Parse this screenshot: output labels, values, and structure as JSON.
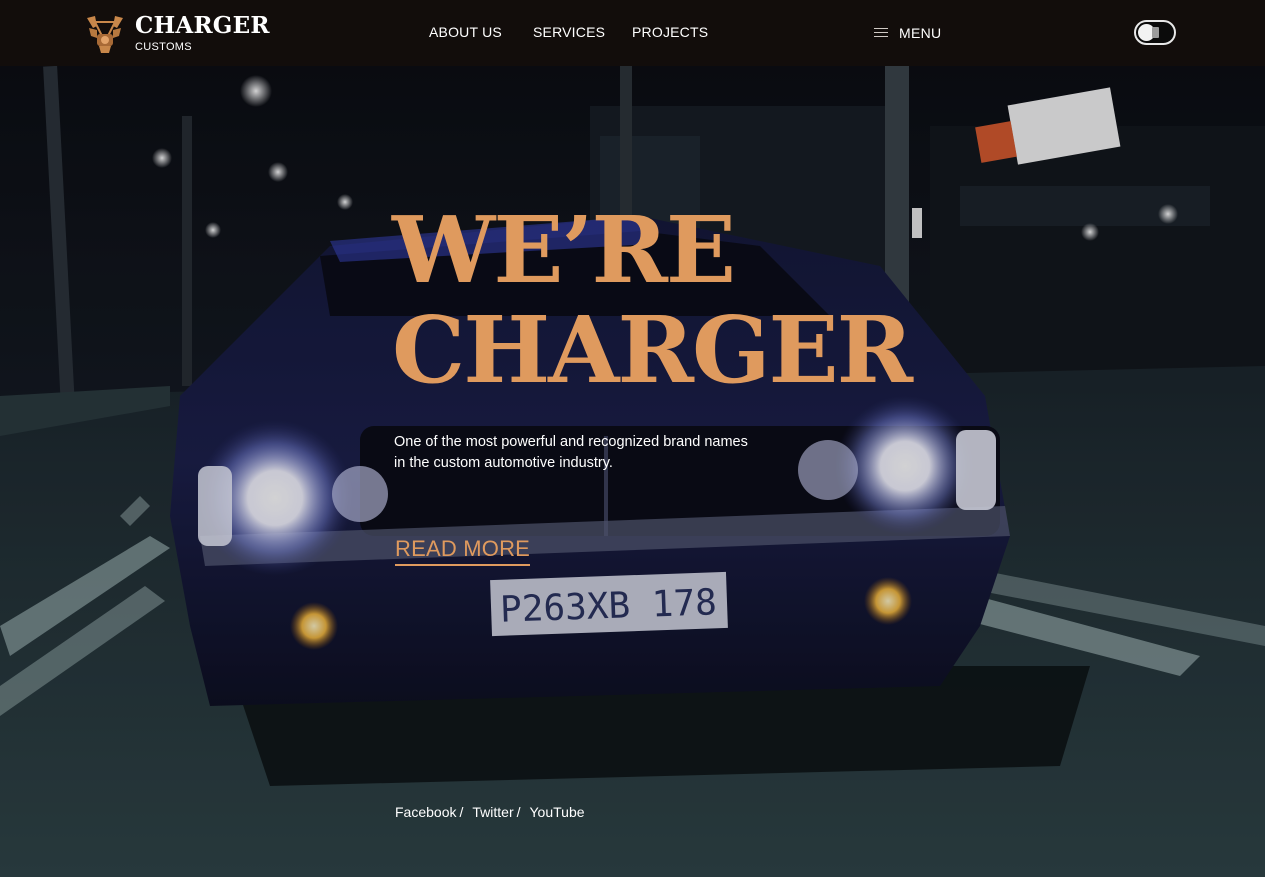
{
  "brand": {
    "name": "CHARGER",
    "sub": "CUSTOMS",
    "logo_icon": "engine-emblem-icon",
    "accent": "#df9a5e"
  },
  "nav": {
    "items": [
      {
        "label": "ABOUT US"
      },
      {
        "label": "SERVICES"
      },
      {
        "label": "PROJECTS"
      }
    ],
    "menu_label": "MENU",
    "menu_icon": "hamburger-icon"
  },
  "theme_toggle": {
    "icon": "toggle-switch-icon",
    "state": "off"
  },
  "hero": {
    "headline_line1": "WE’RE",
    "headline_line2": "CHARGER",
    "lead": "One of the most powerful and recognized brand names in the custom automotive industry.",
    "cta": "READ MORE",
    "plate_text": "P263XB 178"
  },
  "social": {
    "links": [
      "Facebook",
      "Twitter",
      "YouTube"
    ],
    "separator": "/"
  }
}
